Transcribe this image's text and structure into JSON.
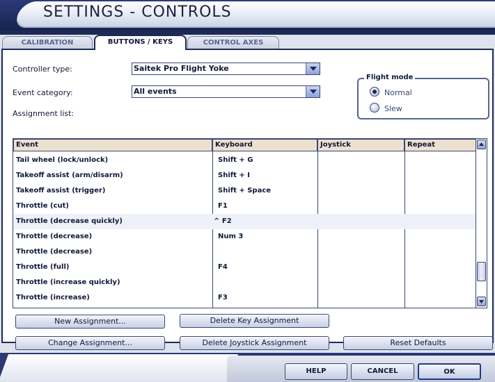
{
  "window": {
    "title": "SETTINGS - CONTROLS"
  },
  "tabs": [
    {
      "label": "CALIBRATION",
      "active": false
    },
    {
      "label": "BUTTONS / KEYS",
      "active": true
    },
    {
      "label": "CONTROL AXES",
      "active": false
    }
  ],
  "form": {
    "controller_type_label": "Controller type:",
    "controller_type_value": "Saitek Pro Flight Yoke",
    "event_category_label": "Event category:",
    "event_category_value": "All events",
    "assignment_list_label": "Assignment list:"
  },
  "flight_mode": {
    "legend": "Flight mode",
    "options": [
      {
        "label": "Normal",
        "selected": true
      },
      {
        "label": "Slew",
        "selected": false
      }
    ]
  },
  "table": {
    "columns": [
      "Event",
      "Keyboard",
      "Joystick",
      "Repeat"
    ],
    "rows": [
      {
        "event": "Tail wheel (lock/unlock)",
        "keyboard": "Shift + G"
      },
      {
        "event": "Takeoff assist (arm/disarm)",
        "keyboard": "Shift + I"
      },
      {
        "event": "Takeoff assist (trigger)",
        "keyboard": "Shift + Space"
      },
      {
        "event": "Throttle (cut)",
        "keyboard": "F1"
      },
      {
        "event": "Throttle (decrease quickly)",
        "keyboard": "^ F2"
      },
      {
        "event": "Throttle (decrease)",
        "keyboard": "Num 3"
      },
      {
        "event": "Throttle (decrease)",
        "keyboard": ""
      },
      {
        "event": "Throttle (full)",
        "keyboard": "F4"
      },
      {
        "event": "Throttle (increase quickly)",
        "keyboard": ""
      },
      {
        "event": "Throttle (increase)",
        "keyboard": "F3"
      }
    ]
  },
  "buttons": {
    "new_assignment": "New Assignment...",
    "delete_key_assignment": "Delete Key Assignment",
    "change_assignment": "Change Assignment...",
    "delete_joystick_assignment": "Delete Joystick Assignment",
    "reset_defaults": "Reset Defaults"
  },
  "footer": {
    "help": "HELP",
    "cancel": "CANCEL",
    "ok": "OK"
  }
}
